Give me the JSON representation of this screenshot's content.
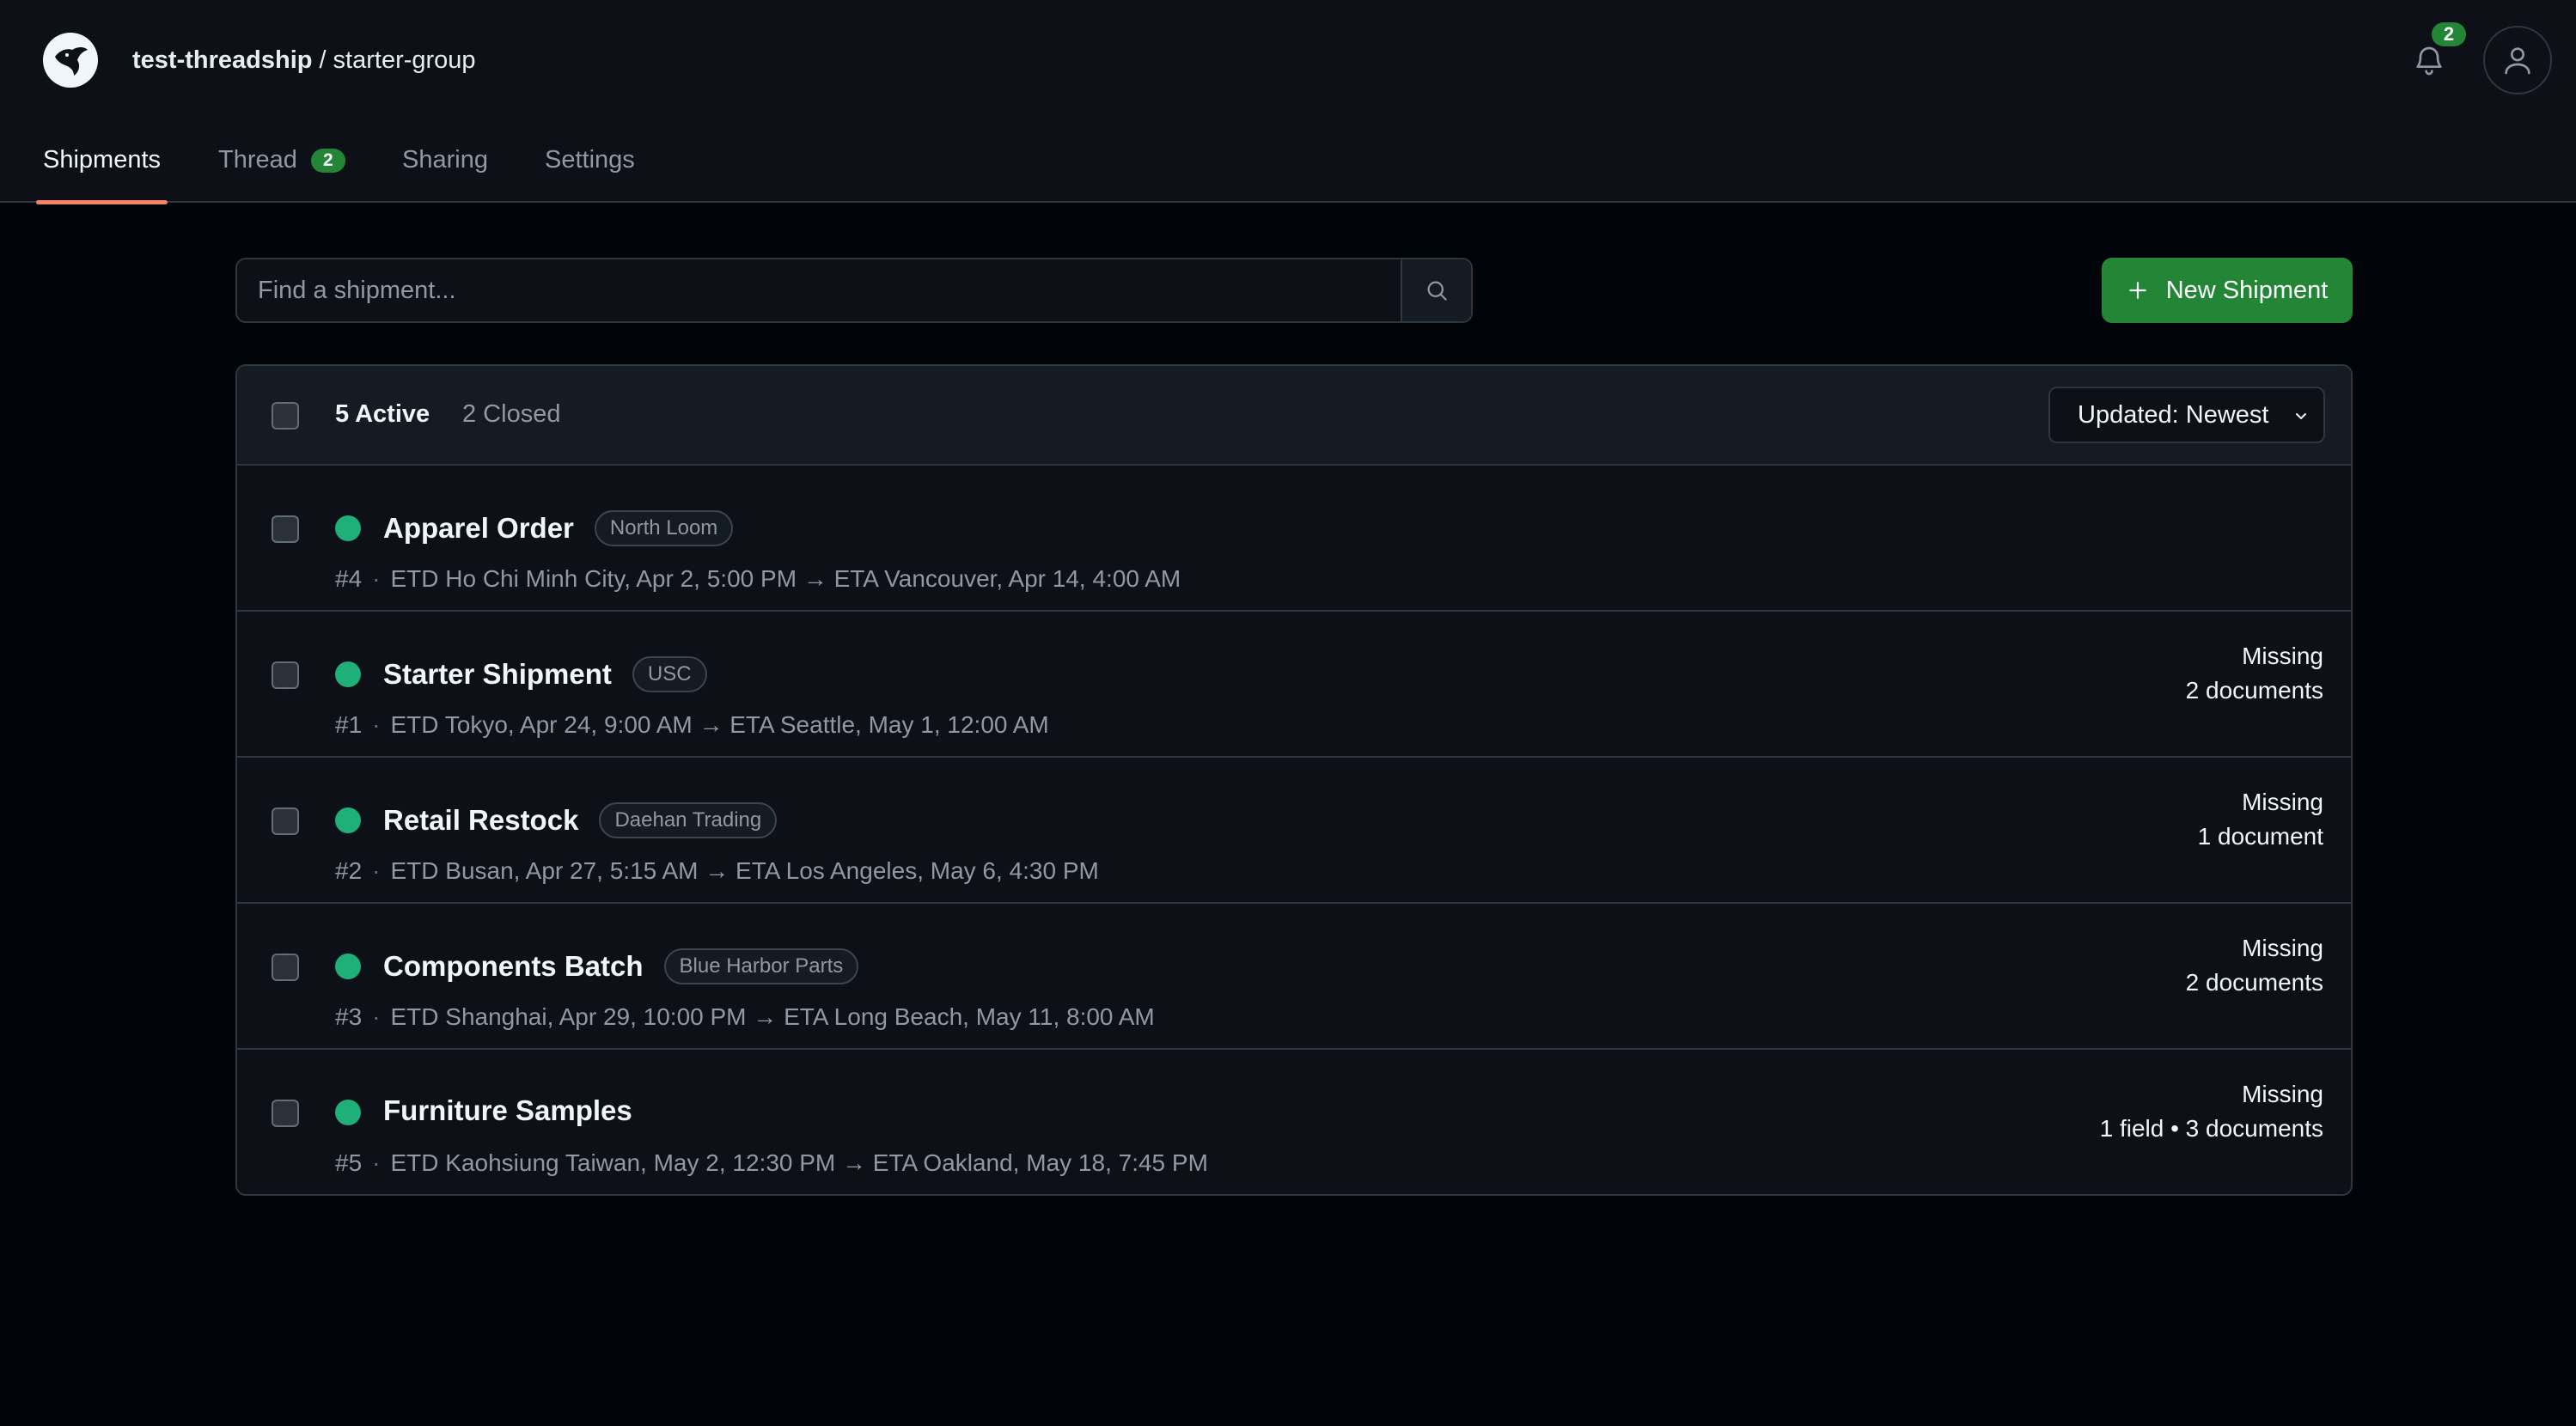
{
  "header": {
    "owner": "test-threadship",
    "separator": "/",
    "repo": "starter-group",
    "notification_count": "2",
    "icons": {
      "logo": "manta-ray-logo-icon",
      "bell": "bell-icon",
      "avatar": "user-icon"
    }
  },
  "tabs": [
    {
      "label": "Shipments",
      "active": true
    },
    {
      "label": "Thread",
      "count": "2"
    },
    {
      "label": "Sharing"
    },
    {
      "label": "Settings"
    }
  ],
  "search": {
    "placeholder": "Find a shipment...",
    "value": ""
  },
  "new_button": {
    "label": "New Shipment"
  },
  "list": {
    "active_label": "5 Active",
    "closed_label": "2 Closed",
    "sort_label": "Updated: Newest",
    "rows": [
      {
        "title": "Apparel Order",
        "tag": "North Loom",
        "number": "#4",
        "route": "ETD Ho Chi Minh City, Apr 2, 5:00 PM → ETA Vancouver, Apr 14, 4:00 AM",
        "status_line1": "",
        "status_line2": ""
      },
      {
        "title": "Starter Shipment",
        "tag": "USC",
        "number": "#1",
        "route": "ETD Tokyo, Apr 24, 9:00 AM → ETA Seattle, May 1, 12:00 AM",
        "status_line1": "Missing",
        "status_line2": "2 documents"
      },
      {
        "title": "Retail Restock",
        "tag": "Daehan Trading",
        "number": "#2",
        "route": "ETD Busan, Apr 27, 5:15 AM → ETA Los Angeles, May 6, 4:30 PM",
        "status_line1": "Missing",
        "status_line2": "1 document"
      },
      {
        "title": "Components Batch",
        "tag": "Blue Harbor Parts",
        "number": "#3",
        "route": "ETD Shanghai, Apr 29, 10:00 PM → ETA Long Beach, May 11, 8:00 AM",
        "status_line1": "Missing",
        "status_line2": "2 documents"
      },
      {
        "title": "Furniture Samples",
        "tag": "",
        "number": "#5",
        "route": "ETD Kaohsiung Taiwan, May 2, 12:30 PM → ETA Oakland, May 18, 7:45 PM",
        "status_line1": "Missing",
        "status_line2": "1 field • 3 documents"
      }
    ]
  },
  "colors": {
    "accent_green": "#238636",
    "status_dot": "#1fb07a",
    "tab_underline": "#f78166"
  }
}
